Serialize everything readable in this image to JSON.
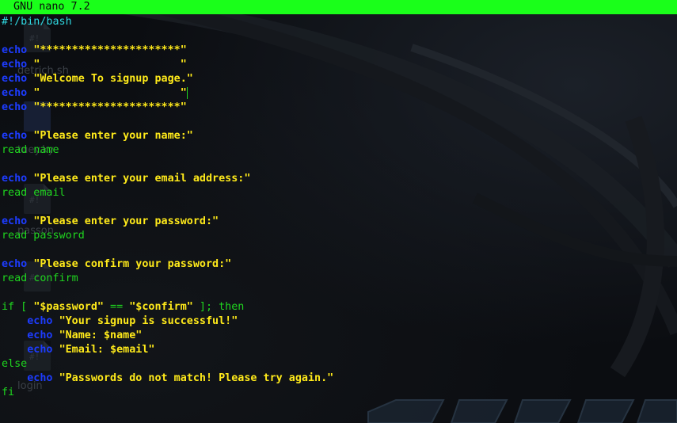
{
  "window": {
    "title": "GNU nano 7.2"
  },
  "desktop": {
    "icons": [
      {
        "label": "detrich.sh",
        "glyph": "#!"
      },
      {
        "label": "tuey.ky",
        "glyph": ""
      },
      {
        "label": "passon",
        "glyph": "#!"
      },
      {
        "label": "",
        "glyph": "#!"
      },
      {
        "label": "login",
        "glyph": "#!"
      }
    ]
  },
  "editor": {
    "lines": [
      "#!/bin/bash",
      "",
      "echo \"**********************\"",
      "echo \"                      \"",
      "echo \"Welcome To signup page.\"",
      "echo \"                      \"",
      "echo \"**********************\"",
      "",
      "echo \"Please enter your name:\"",
      "read name",
      "",
      "echo \"Please enter your email address:\"",
      "read email",
      "",
      "echo \"Please enter your password:\"",
      "read password",
      "",
      "echo \"Please confirm your password:\"",
      "read confirm",
      "",
      "if [ \"$password\" == \"$confirm\" ]; then",
      "    echo \"Your signup is successful!\"",
      "    echo \"Name: $name\"",
      "    echo \"Email: $email\"",
      "else",
      "    echo \"Passwords do not match! Please try again.\"",
      "fi"
    ]
  },
  "colors": {
    "titlebar_bg": "#1aff1a",
    "keyword_echo": "#1d3cff",
    "string": "#ffea1a",
    "keyword_green": "#1fd61f",
    "shebang": "#2fd7e0"
  }
}
